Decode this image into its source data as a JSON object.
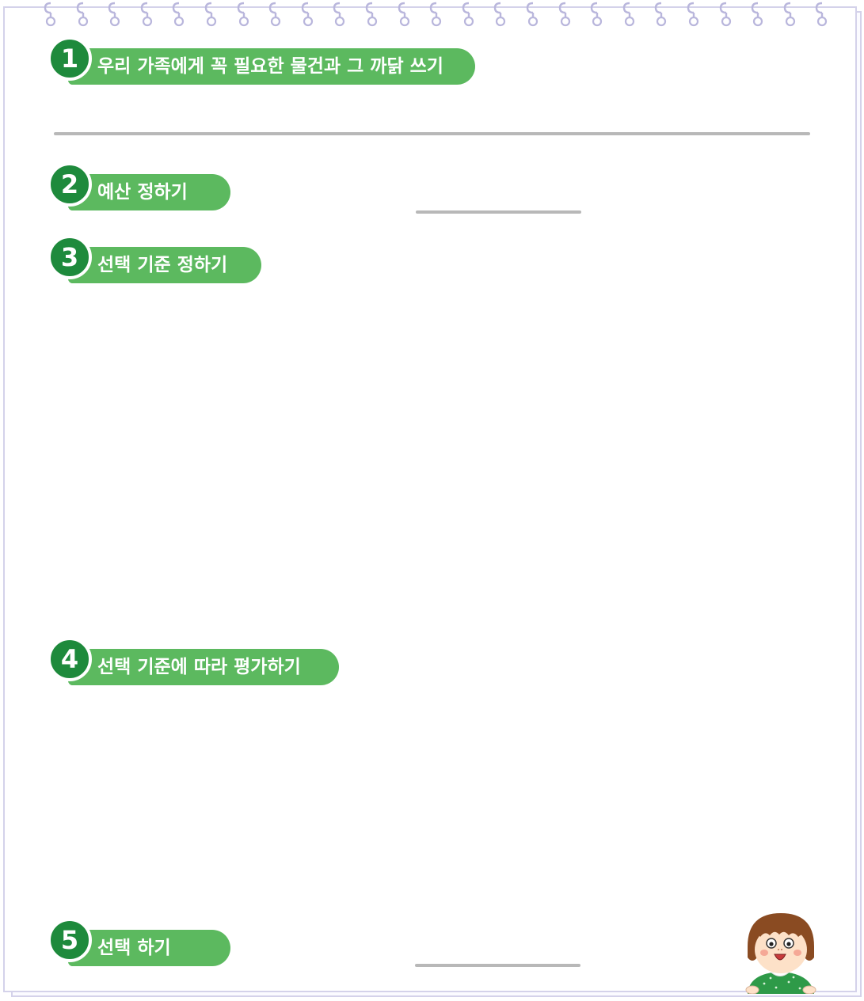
{
  "steps": [
    {
      "number": "1",
      "label": "우리 가족에게 꼭 필요한 물건과 그 까닭 쓰기"
    },
    {
      "number": "2",
      "label": "예산 정하기"
    },
    {
      "number": "3",
      "label": "선택 기준 정하기"
    },
    {
      "number": "4",
      "label": "선택 기준에 따라 평가하기"
    },
    {
      "number": "5",
      "label": "선택 하기"
    }
  ],
  "colors": {
    "pill_green": "#5cb95f",
    "badge_green": "#1e8a3c",
    "border_lavender": "#d4d2ea",
    "line_gray": "#b8b8b8"
  }
}
